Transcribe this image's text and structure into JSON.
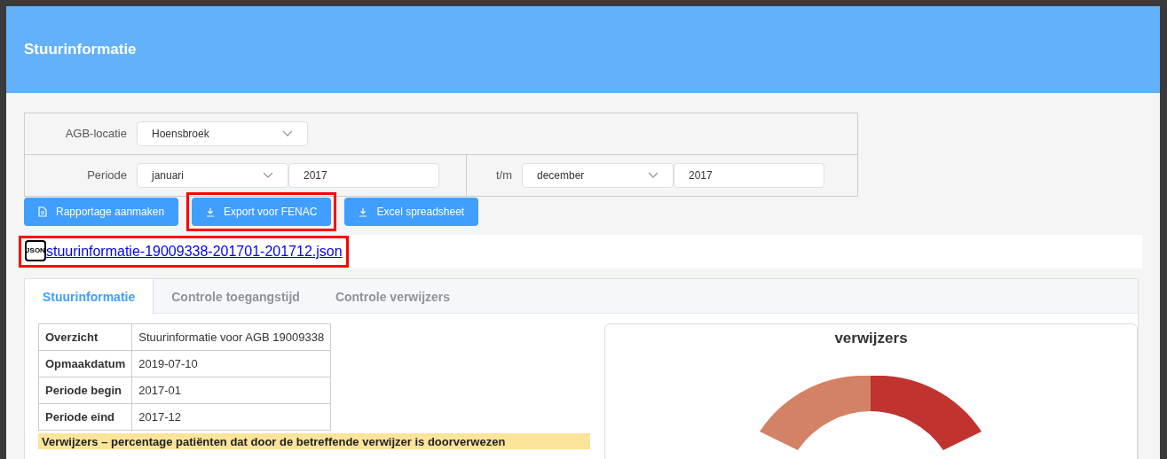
{
  "header": {
    "title": "Stuurinformatie"
  },
  "filters": {
    "location": {
      "label": "AGB-locatie",
      "value": "Hoensbroek"
    },
    "period": {
      "label": "Periode",
      "from_month": "januari",
      "from_year": "2017",
      "separator": "t/m",
      "to_month": "december",
      "to_year": "2017"
    }
  },
  "buttons": [
    {
      "label": "Rapportage aanmaken",
      "kind": "document",
      "highlighted": false
    },
    {
      "label": "Export voor FENAC",
      "kind": "download",
      "highlighted": true
    },
    {
      "label": "Excel spreadsheet",
      "kind": "download",
      "highlighted": false
    }
  ],
  "download": {
    "badge": "JSON",
    "filename": "stuurinformatie-19009338-201701-201712.json",
    "highlighted": true
  },
  "tabs": [
    {
      "label": "Stuurinformatie",
      "selected": true
    },
    {
      "label": "Controle toegangstijd",
      "selected": false
    },
    {
      "label": "Controle verwijzers",
      "selected": false
    }
  ],
  "overview": [
    {
      "key": "Overzicht",
      "value": "Stuurinformatie voor AGB 19009338"
    },
    {
      "key": "Opmaakdatum",
      "value": "2019-07-10"
    },
    {
      "key": "Periode begin",
      "value": "2017-01"
    },
    {
      "key": "Periode eind",
      "value": "2017-12"
    }
  ],
  "notice": "Verwijzers – percentage patiënten dat door de betreffende verwijzer is doorverwezen",
  "chart": {
    "title": "verwijzers"
  }
}
